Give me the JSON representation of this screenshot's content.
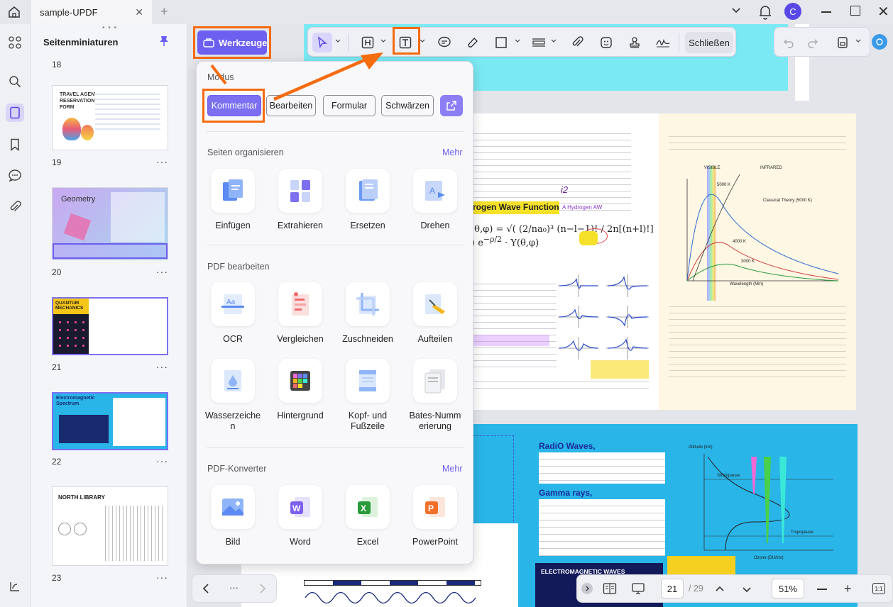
{
  "app": {
    "tab_title": "sample-UPDF",
    "avatar_letter": "C"
  },
  "thumbnails": {
    "title": "Seitenminiaturen",
    "pages": [
      {
        "label": "19",
        "preview_title": "TRAVEL AGENT RESERVATION FORM"
      },
      {
        "label": "20",
        "preview_title": "Geometry"
      },
      {
        "label": "21",
        "preview_title": "QUANTUM MECHANICS"
      },
      {
        "label": "22",
        "preview_title": "Electromagnetic Spectrum"
      },
      {
        "label": "23",
        "preview_title": "NORTH LIBRARY"
      }
    ],
    "more_label": "···"
  },
  "toolbar": {
    "werkzeuge_label": "Werkzeuge",
    "close_label": "Schließen"
  },
  "menu": {
    "modes_title": "Modus",
    "modes": [
      "Kommentar",
      "Bearbeiten",
      "Formular",
      "Schwärzen"
    ],
    "organize_title": "Seiten organisieren",
    "organize_more": "Mehr",
    "organize_items": [
      "Einfügen",
      "Extrahieren",
      "Ersetzen",
      "Drehen"
    ],
    "edit_title": "PDF bearbeiten",
    "edit_items": [
      "OCR",
      "Vergleichen",
      "Zuschneiden",
      "Aufteilen",
      "Wasserzeichen",
      "Hintergrund",
      "Kopf- und Fußzeile",
      "Bates-Nummerierung"
    ],
    "edit_items_display": [
      "OCR",
      "Vergleichen",
      "Zuschneiden",
      "Aufteilen",
      "Wasserzeiche\nn",
      "Hintergrund",
      "Kopf- und\nFußzeile",
      "Bates-Numm\nerierung"
    ],
    "convert_title": "PDF-Konverter",
    "convert_more": "Mehr",
    "convert_items": [
      "Bild",
      "Word",
      "Excel",
      "PowerPoint"
    ]
  },
  "document": {
    "heading_wave": "rogen Wave Function",
    "hydrogen": "A Hydrogen AW",
    "radio_title": "RadiO Waves,",
    "gamma_title": "Gamma rays,",
    "em_box": "ELECTROMAGNETIC WAVES",
    "visible": "VISIBLE",
    "infrared": "INFRARED",
    "classical": "Classical Theory (5000 K)",
    "k5000": "5000 K",
    "k4000": "4000 K",
    "k3000": "3000 K",
    "wavelength": "Wavelength (Mm)",
    "stratopause": "Stratopause",
    "tropopause": "Tropopause",
    "altitude": "Altitude (km)",
    "ozone": "Ozone (DU/km)"
  },
  "statusbar": {
    "page_current": "21",
    "page_total": "/ 29",
    "zoom": "51%",
    "nav_more": "···"
  },
  "colors": {
    "accent": "#6d5ff0",
    "highlight_annotation": "#f56b0f"
  }
}
